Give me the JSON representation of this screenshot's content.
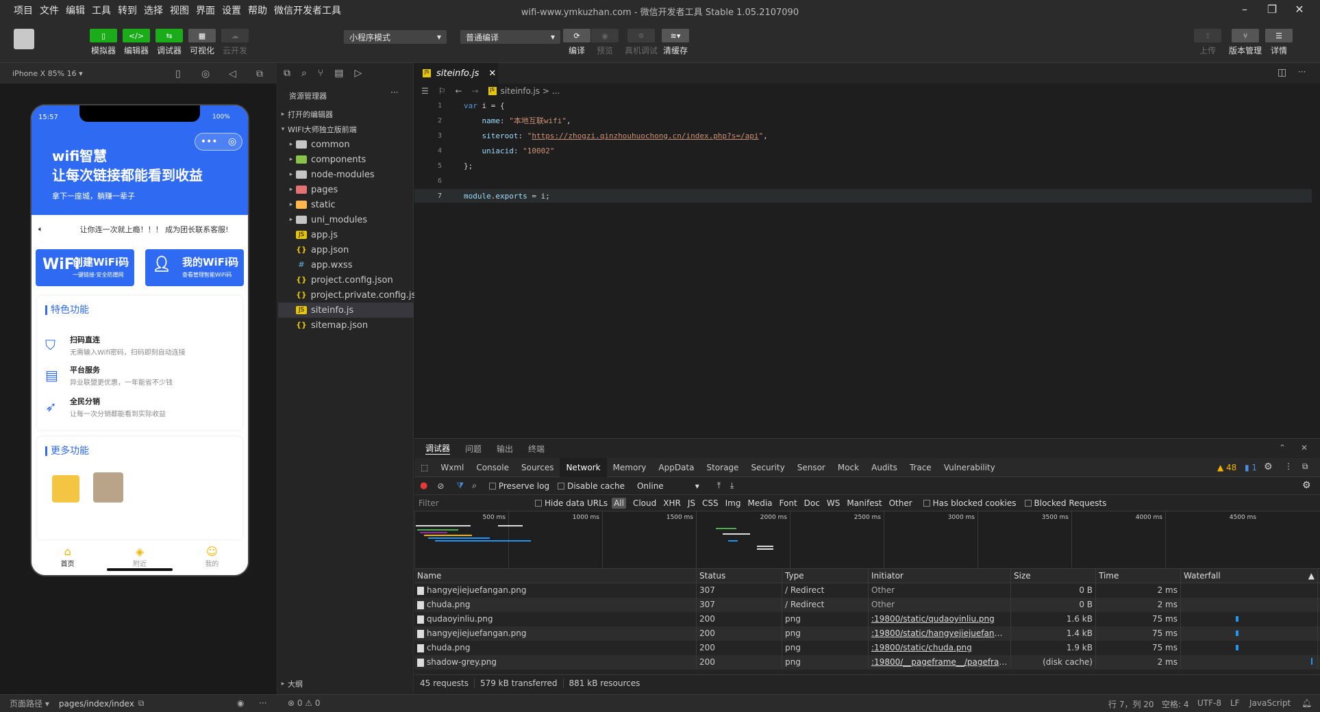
{
  "menu": {
    "items": [
      "项目",
      "文件",
      "编辑",
      "工具",
      "转到",
      "选择",
      "视图",
      "界面",
      "设置",
      "帮助",
      "微信开发者工具"
    ],
    "title": "wifi-www.ymkuzhan.com - 微信开发者工具 Stable 1.05.2107090"
  },
  "toolbar": {
    "simulator": "模拟器",
    "editor": "编辑器",
    "debugger": "调试器",
    "visual": "可视化",
    "cloud": "云开发",
    "mode_select": "小程序模式",
    "compile_select": "普通编译",
    "compile": "编译",
    "preview": "预览",
    "real_debug": "真机调试",
    "clear_cache": "清缓存",
    "upload": "上传",
    "version": "版本管理",
    "details": "详情"
  },
  "simulator": {
    "device": "iPhone X 85% 16",
    "time": "15:57",
    "battery": "100%",
    "hero_title1": "wifi智慧",
    "hero_title2": "让每次链接都能看到收益",
    "hero_sub": "拿下一座城，躺赚一辈子",
    "notice": "让你连一次就上瘾！！！ 成为团长联系客服!",
    "create_wifi": "创建WiFi码",
    "create_wifi_sub": "一键链接·安全防蹭网",
    "my_wifi": "我的WiFi码",
    "my_wifi_sub": "查看管理智能WiFi码",
    "features_title": "特色功能",
    "features": [
      {
        "title": "扫码直连",
        "desc": "无需输入Wifi密码，扫码即刻自动连接"
      },
      {
        "title": "平台服务",
        "desc": "异业联盟更优惠，一年能省不少钱"
      },
      {
        "title": "全民分销",
        "desc": "让每一次分销都能看到实际收益"
      }
    ],
    "more_title": "更多功能",
    "tabs": [
      "首页",
      "附近",
      "我的"
    ]
  },
  "explorer": {
    "title": "资源管理器",
    "open_editors": "打开的编辑器",
    "project": "WIFI大师独立版前端",
    "folders": [
      "common",
      "components",
      "node-modules",
      "pages",
      "static",
      "uni_modules"
    ],
    "files": [
      "app.js",
      "app.json",
      "app.wxss",
      "project.config.json",
      "project.private.config.js...",
      "siteinfo.js",
      "sitemap.json"
    ],
    "outline": "大纲",
    "problems": "⊗ 0 ⚠ 0"
  },
  "editor": {
    "tab": "siteinfo.js",
    "breadcrumb": "siteinfo.js > ...",
    "line_numbers": [
      "1",
      "2",
      "3",
      "4",
      "5",
      "6",
      "7"
    ]
  },
  "devtools": {
    "top_tabs": [
      "调试器",
      "问题",
      "输出",
      "终端"
    ],
    "tabs": [
      "Wxml",
      "Console",
      "Sources",
      "Network",
      "Memory",
      "AppData",
      "Storage",
      "Security",
      "Sensor",
      "Mock",
      "Audits",
      "Trace",
      "Vulnerability"
    ],
    "warnings": "▲ 48",
    "messages": "▮ 1",
    "preserve_log": "Preserve log",
    "disable_cache": "Disable cache",
    "online": "Online",
    "filter_placeholder": "Filter",
    "hide_data_urls": "Hide data URLs",
    "filter_types": [
      "All",
      "Cloud",
      "XHR",
      "JS",
      "CSS",
      "Img",
      "Media",
      "Font",
      "Doc",
      "WS",
      "Manifest",
      "Other"
    ],
    "blocked_cookies": "Has blocked cookies",
    "blocked_requests": "Blocked Requests",
    "ticks": [
      "500 ms",
      "1000 ms",
      "1500 ms",
      "2000 ms",
      "2500 ms",
      "3000 ms",
      "3500 ms",
      "4000 ms",
      "4500 ms"
    ],
    "columns": [
      "Name",
      "Status",
      "Type",
      "Initiator",
      "Size",
      "Time",
      "Waterfall"
    ],
    "rows": [
      {
        "name": "hangyejiejuefangan.png",
        "status": "307",
        "type": "/ Redirect",
        "initiator": "Other",
        "size": "0 B",
        "time": "2 ms"
      },
      {
        "name": "chuda.png",
        "status": "307",
        "type": "/ Redirect",
        "initiator": "Other",
        "size": "0 B",
        "time": "2 ms"
      },
      {
        "name": "qudaoyinliu.png",
        "status": "200",
        "type": "png",
        "initiator": ":19800/static/qudaoyinliu.png",
        "size": "1.6 kB",
        "time": "75 ms"
      },
      {
        "name": "hangyejiejuefangan.png",
        "status": "200",
        "type": "png",
        "initiator": ":19800/static/hangyejiejuefangan.p...",
        "size": "1.4 kB",
        "time": "75 ms"
      },
      {
        "name": "chuda.png",
        "status": "200",
        "type": "png",
        "initiator": ":19800/static/chuda.png",
        "size": "1.9 kB",
        "time": "75 ms"
      },
      {
        "name": "shadow-grey.png",
        "status": "200",
        "type": "png",
        "initiator": ":19800/__pageframe__/pageframe.h...",
        "size": "(disk cache)",
        "time": "2 ms"
      }
    ],
    "summary": [
      "45 requests",
      "579 kB transferred",
      "881 kB resources"
    ]
  },
  "statusbar": {
    "page_path_label": "页面路径",
    "page_path": "pages/index/index",
    "cursor": "行 7，列 20",
    "spaces": "空格: 4",
    "encoding": "UTF-8",
    "eol": "LF",
    "language": "JavaScript"
  },
  "colors": {
    "accent_green": "#1aad19",
    "phone_blue": "#2f6bf2"
  }
}
